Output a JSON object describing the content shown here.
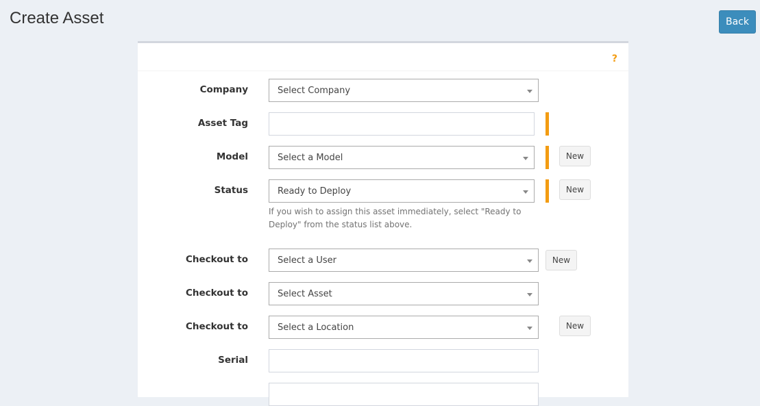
{
  "header": {
    "title": "Create Asset",
    "back_label": "Back"
  },
  "panel": {
    "help_icon": "?"
  },
  "form": {
    "company": {
      "label": "Company",
      "value": "Select Company"
    },
    "asset_tag": {
      "label": "Asset Tag",
      "value": ""
    },
    "model": {
      "label": "Model",
      "value": "Select a Model",
      "new_label": "New"
    },
    "status": {
      "label": "Status",
      "value": "Ready to Deploy",
      "new_label": "New",
      "help": "If you wish to assign this asset immediately, select \"Ready to Deploy\" from the status list above."
    },
    "checkout_user": {
      "label": "Checkout to",
      "value": "Select a User",
      "new_label": "New"
    },
    "checkout_asset": {
      "label": "Checkout to",
      "value": "Select Asset"
    },
    "checkout_location": {
      "label": "Checkout to",
      "value": "Select a Location",
      "new_label": "New"
    },
    "serial": {
      "label": "Serial",
      "value": ""
    }
  },
  "colors": {
    "accent": "#3c8dbc",
    "required": "#f39c12",
    "background": "#ecf0f5"
  }
}
